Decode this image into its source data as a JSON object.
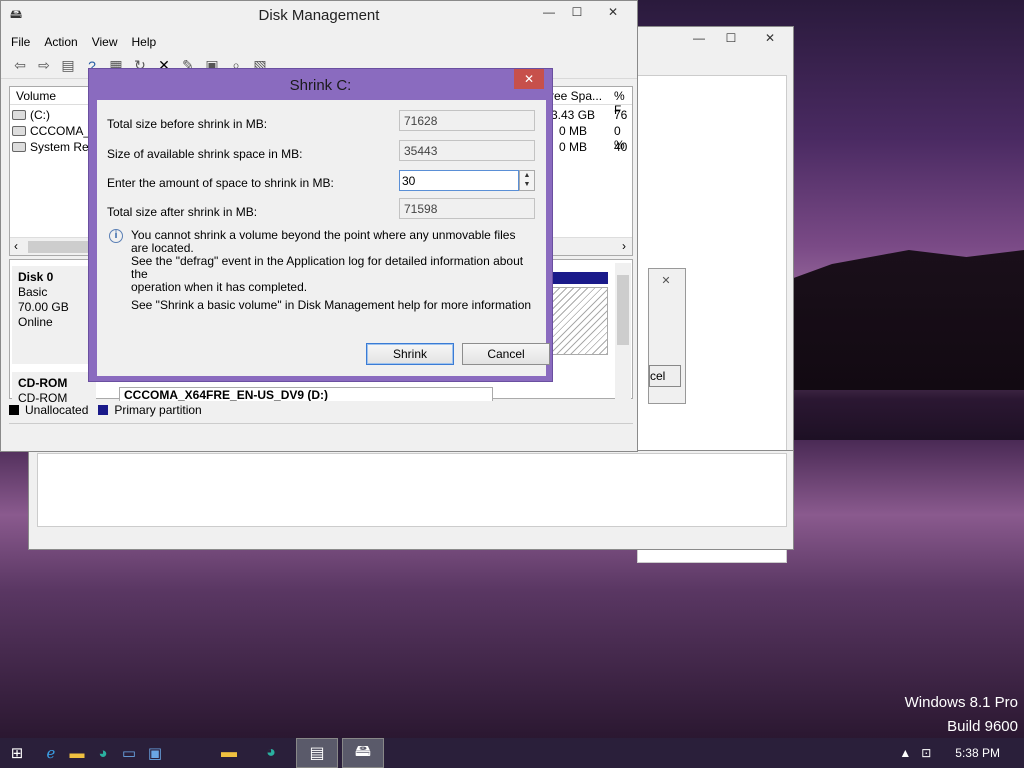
{
  "desktop": {
    "watermark_line1": "Windows 8.1 Pro",
    "watermark_line2": "Build 9600"
  },
  "disk_management": {
    "title": "Disk Management",
    "caption": {
      "minimize": "—",
      "maximize": "☐",
      "close": "✕"
    },
    "menu": [
      "File",
      "Action",
      "View",
      "Help"
    ],
    "toolbar_icons": [
      "back-icon",
      "forward-icon",
      "list-icon",
      "help-icon",
      "properties-icon",
      "refresh-icon",
      "delete-icon",
      "format-icon",
      "open-icon",
      "search-icon",
      "explore-icon"
    ],
    "columns": {
      "volume": "Volume",
      "free_space": "ree Spa...",
      "percent_free": "% F"
    },
    "volumes": [
      {
        "name": "(C:)",
        "free": "3.43 GB",
        "pct": "76"
      },
      {
        "name": "CCCOMA_",
        "free": "0 MB",
        "pct": "0 %"
      },
      {
        "name": "System Res",
        "free": "0 MB",
        "pct": "40"
      }
    ],
    "disks": [
      {
        "name": "Disk 0",
        "type": "Basic",
        "size": "70.00 GB",
        "status": "Online"
      },
      {
        "name": "CD-ROM",
        "type": "CD-ROM",
        "size": "",
        "status": ""
      }
    ],
    "cdrom_volume_label": "CCCOMA_X64FRE_EN-US_DV9 (D:)",
    "legend": [
      {
        "label": "Unallocated",
        "color": "#000000"
      },
      {
        "label": "Primary partition",
        "color": "#1a1a8a"
      }
    ]
  },
  "background_window": {
    "partial_button_text": "cel"
  },
  "shrink_dialog": {
    "title": "Shrink C:",
    "close": "✕",
    "total_before_label": "Total size before shrink in MB:",
    "total_before_value": "71628",
    "available_label": "Size of available shrink space in MB:",
    "available_value": "35443",
    "amount_label": "Enter the amount of space to shrink in MB:",
    "amount_value": "30",
    "total_after_label": "Total size after shrink in MB:",
    "total_after_value": "71598",
    "info_line1": "You cannot shrink a volume beyond the point where any unmovable files are located.",
    "info_line2": "See the \"defrag\" event in the Application log for detailed information about the",
    "info_line3": "operation when it has completed.",
    "help_text": "See \"Shrink a basic volume\" in Disk Management help for more information",
    "shrink_button": "Shrink",
    "cancel_button": "Cancel"
  },
  "taskbar": {
    "clock": "5:38 PM",
    "apps": [
      "start-icon",
      "ie-icon",
      "explorer-icon",
      "store-icon",
      "desktop-icon",
      "remote-icon",
      "folder-icon",
      "edge-icon",
      "notepad-icon",
      "disk-mgmt-icon"
    ]
  }
}
